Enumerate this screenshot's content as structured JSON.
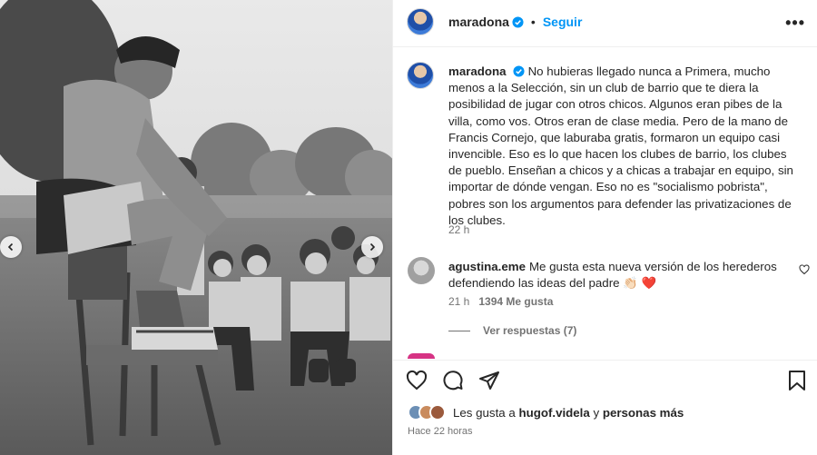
{
  "post": {
    "username": "maradona",
    "follow_label": "Seguir",
    "more_label": "•••",
    "caption": "No hubieras llegado nunca a Primera, mucho menos a la Selección, sin un club de barrio que te diera la posibilidad de jugar con otros chicos. Algunos eran pibes de la villa, como vos. Otros eran de clase media. Pero de la mano de Francis Cornejo, que laburaba gratis, formaron un equipo casi invencible. Eso es lo que hacen los clubes de barrio, los clubes de pueblo. Enseñan a chicos y a chicas a trabajar en equipo, sin importar de dónde vengan. Eso no es \"socialismo pobrista\", pobres son los argumentos para defender las privatizaciones de los clubes.",
    "caption_time": "22 h"
  },
  "comment": {
    "username": "agustina.eme",
    "text": "Me gusta esta nueva versión de los herederos defendiendo las ideas del padre 👏🏻 ❤️",
    "time": "21 h",
    "likes": "1394 Me gusta",
    "view_replies": "Ver respuestas (7)"
  },
  "footer": {
    "likes_prefix": "Les gusta a",
    "likes_user": "hugof.videla",
    "likes_mid": "y",
    "likes_suffix": "personas más",
    "post_time": "Hace 22 horas"
  },
  "icons": {
    "verified": "verified-badge-icon",
    "heart": "heart-icon",
    "comment": "comment-icon",
    "share": "share-icon",
    "save": "bookmark-icon",
    "prev": "chevron-left-icon",
    "next": "chevron-right-icon"
  },
  "colors": {
    "accent": "#0095f6",
    "verified": "#0095f6",
    "text": "#262626",
    "secondary": "#737373"
  }
}
